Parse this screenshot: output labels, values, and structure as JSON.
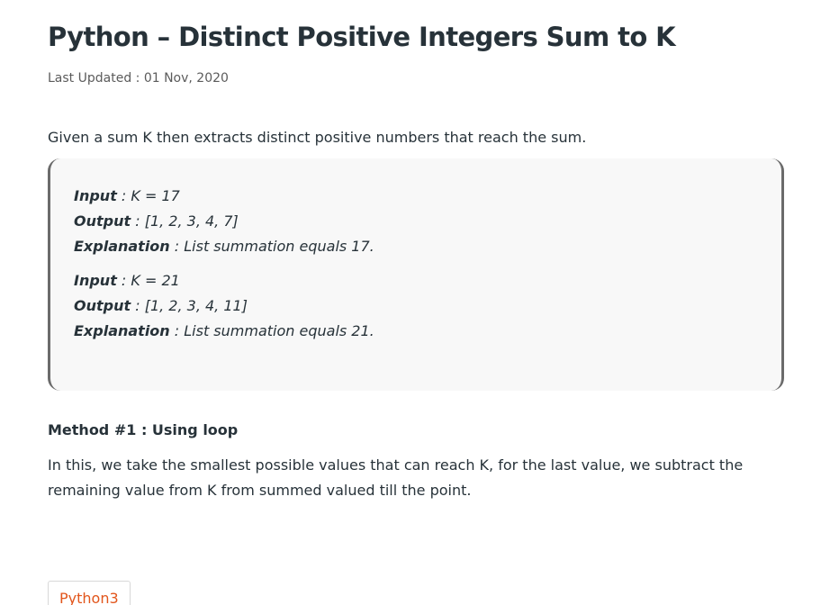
{
  "article": {
    "title": "Python – Distinct Positive Integers Sum to K",
    "last_updated": "Last Updated : 01 Nov, 2020",
    "intro": "Given a sum K then extracts distinct positive numbers that reach the sum."
  },
  "examples": [
    {
      "input_label": "Input",
      "input_value": " : K = 17",
      "output_label": "Output",
      "output_value": " : [1, 2, 3, 4, 7]",
      "explanation_label": "Explanation",
      "explanation_value": " : List summation equals 17."
    },
    {
      "input_label": "Input",
      "input_value": " : K = 21",
      "output_label": "Output",
      "output_value": " : [1, 2, 3, 4, 11]",
      "explanation_label": "Explanation",
      "explanation_value": " : List summation equals 21."
    }
  ],
  "method": {
    "heading": "Method #1 : Using loop",
    "description": "In this, we take the smallest possible values that can reach K, for the last value, we subtract the remaining value from K from summed valued till the point."
  },
  "code_tabs": [
    {
      "label": "Python3"
    }
  ],
  "colors": {
    "text": "#273239",
    "tab_accent": "#e2561c",
    "box_border": "#6b6b6b",
    "box_background": "#f8f8f8"
  }
}
